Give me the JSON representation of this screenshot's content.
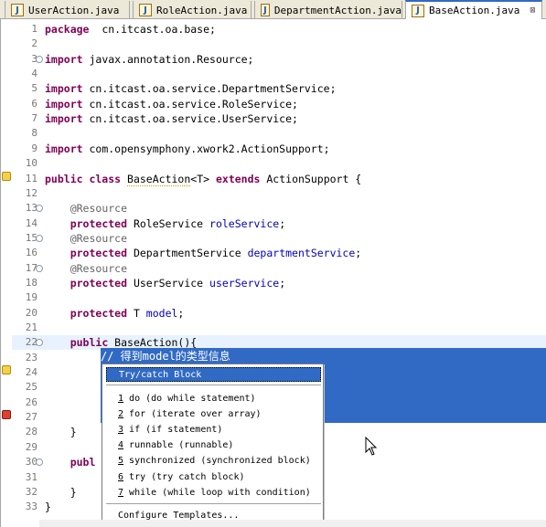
{
  "tabs": [
    {
      "label": "UserAction.java",
      "active": false
    },
    {
      "label": "RoleAction.java",
      "active": false
    },
    {
      "label": "DepartmentAction.java",
      "active": false
    },
    {
      "label": "BaseAction.java",
      "active": true
    }
  ],
  "tab_icon_letter": "J",
  "close_glyph": "⊠",
  "lines": [
    {
      "n": "1",
      "fold": "",
      "segs": [
        [
          "kw",
          "package"
        ],
        [
          "",
          "  cn.itcast.oa.base;"
        ]
      ]
    },
    {
      "n": "2",
      "fold": "",
      "segs": []
    },
    {
      "n": "3",
      "fold": "⊖",
      "segs": [
        [
          "kw",
          "import"
        ],
        [
          "",
          " javax.annotation.Resource;"
        ]
      ]
    },
    {
      "n": "4",
      "fold": "",
      "segs": []
    },
    {
      "n": "5",
      "fold": "",
      "segs": [
        [
          "kw",
          "import"
        ],
        [
          "",
          " cn.itcast.oa.service.DepartmentService;"
        ]
      ]
    },
    {
      "n": "6",
      "fold": "",
      "segs": [
        [
          "kw",
          "import"
        ],
        [
          "",
          " cn.itcast.oa.service.RoleService;"
        ]
      ]
    },
    {
      "n": "7",
      "fold": "",
      "segs": [
        [
          "kw",
          "import"
        ],
        [
          "",
          " cn.itcast.oa.service.UserService;"
        ]
      ]
    },
    {
      "n": "8",
      "fold": "",
      "segs": []
    },
    {
      "n": "9",
      "fold": "",
      "segs": [
        [
          "kw",
          "import"
        ],
        [
          "",
          " com.opensymphony.xwork2.ActionSupport;"
        ]
      ]
    },
    {
      "n": "10",
      "fold": "",
      "segs": []
    },
    {
      "n": "11",
      "fold": "",
      "segs": [
        [
          "kw",
          "public class"
        ],
        [
          "",
          " "
        ],
        [
          "ul",
          "BaseAction"
        ],
        [
          "",
          "<T> "
        ],
        [
          "kw",
          "extends"
        ],
        [
          "",
          " ActionSupport {"
        ]
      ]
    },
    {
      "n": "12",
      "fold": "",
      "segs": []
    },
    {
      "n": "13",
      "fold": "⊖",
      "segs": [
        [
          "",
          "    "
        ],
        [
          "ann",
          "@Resource"
        ]
      ]
    },
    {
      "n": "14",
      "fold": "",
      "segs": [
        [
          "",
          "    "
        ],
        [
          "kw",
          "protected"
        ],
        [
          "",
          " RoleService "
        ],
        [
          "fld",
          "roleService"
        ],
        [
          "",
          ";"
        ]
      ]
    },
    {
      "n": "15",
      "fold": "⊖",
      "segs": [
        [
          "",
          "    "
        ],
        [
          "ann",
          "@Resource"
        ]
      ]
    },
    {
      "n": "16",
      "fold": "",
      "segs": [
        [
          "",
          "    "
        ],
        [
          "kw",
          "protected"
        ],
        [
          "",
          " DepartmentService "
        ],
        [
          "fld",
          "departmentService"
        ],
        [
          "",
          ";"
        ]
      ]
    },
    {
      "n": "17",
      "fold": "⊖",
      "segs": [
        [
          "",
          "    "
        ],
        [
          "ann",
          "@Resource"
        ]
      ]
    },
    {
      "n": "18",
      "fold": "",
      "segs": [
        [
          "",
          "    "
        ],
        [
          "kw",
          "protected"
        ],
        [
          "",
          " UserService "
        ],
        [
          "fld",
          "userService"
        ],
        [
          "",
          ";"
        ]
      ]
    },
    {
      "n": "19",
      "fold": "",
      "segs": []
    },
    {
      "n": "20",
      "fold": "",
      "segs": [
        [
          "",
          "    "
        ],
        [
          "kw",
          "protected"
        ],
        [
          "",
          " T "
        ],
        [
          "fld",
          "model"
        ],
        [
          "",
          ";"
        ]
      ]
    },
    {
      "n": "21",
      "fold": "",
      "segs": []
    },
    {
      "n": "22",
      "fold": "⊖",
      "segs": [
        [
          "",
          "    "
        ],
        [
          "kw",
          "public"
        ],
        [
          "",
          " BaseAction(){"
        ]
      ]
    },
    {
      "n": "23",
      "fold": "",
      "segs": []
    },
    {
      "n": "24",
      "fold": "",
      "segs": []
    },
    {
      "n": "25",
      "fold": "",
      "segs": []
    },
    {
      "n": "26",
      "fold": "",
      "segs": []
    },
    {
      "n": "27",
      "fold": "",
      "segs": []
    },
    {
      "n": "28",
      "fold": "",
      "segs": [
        [
          "",
          "    }"
        ]
      ]
    },
    {
      "n": "29",
      "fold": "",
      "segs": []
    },
    {
      "n": "30",
      "fold": "⊖",
      "segs": [
        [
          "",
          "    "
        ],
        [
          "kw",
          "publ"
        ]
      ]
    },
    {
      "n": "31",
      "fold": "",
      "segs": []
    },
    {
      "n": "32",
      "fold": "",
      "segs": [
        [
          "",
          "    }"
        ]
      ]
    },
    {
      "n": "33",
      "fold": "",
      "segs": [
        [
          "",
          "}"
        ]
      ]
    }
  ],
  "selected_comment": "// 得到model的类型信息",
  "popup": {
    "top_item": "Try/catch Block",
    "items": [
      {
        "num": "1",
        "text": " do (do while statement)"
      },
      {
        "num": "2",
        "text": " for (iterate over array)"
      },
      {
        "num": "3",
        "text": " if (if statement)"
      },
      {
        "num": "4",
        "text": " runnable (runnable)"
      },
      {
        "num": "5",
        "text": " synchronized (synchronized block)"
      },
      {
        "num": "6",
        "text": " try (try catch block)"
      },
      {
        "num": "7",
        "text": " while (while loop with condition)"
      }
    ],
    "configure": "Configure Templates..."
  },
  "colors": {
    "keyword": "#7f0055",
    "annotation": "#646464",
    "field": "#0000c0",
    "selection": "#316ac5"
  }
}
